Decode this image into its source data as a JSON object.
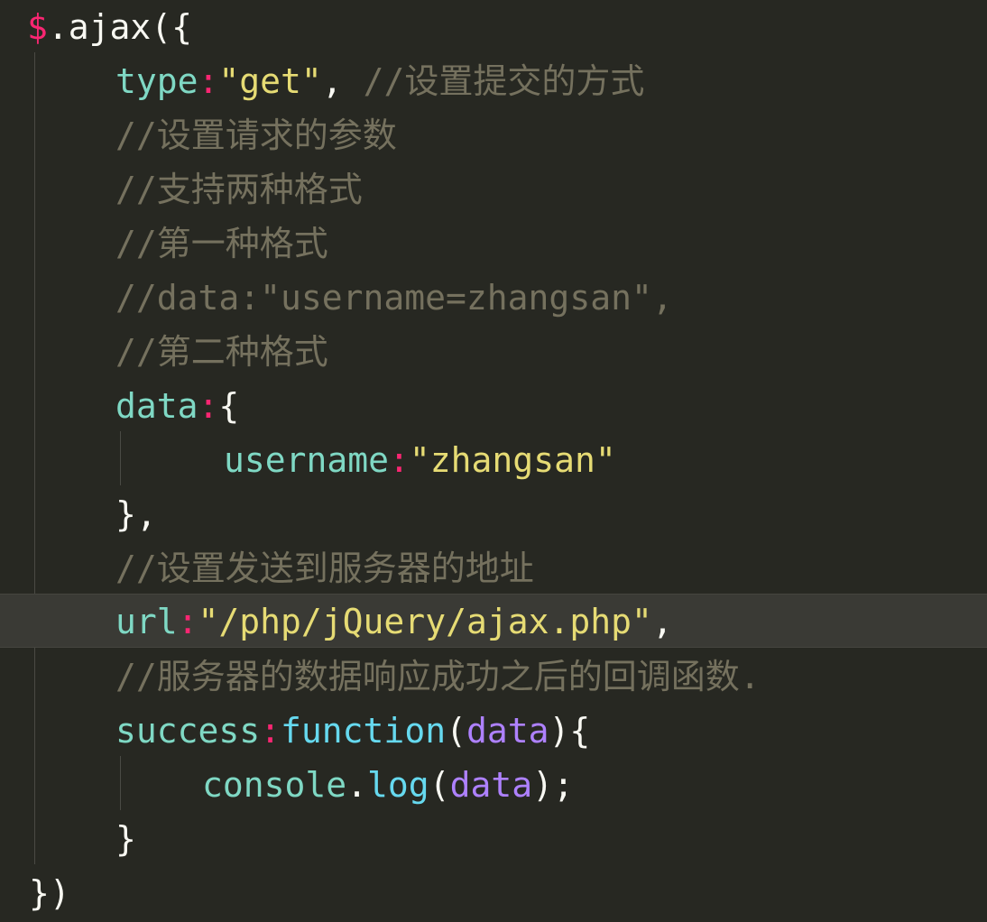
{
  "editor": {
    "theme_colors": {
      "background": "#272822",
      "dollar": "#f92672",
      "key": "#66d9ef",
      "string": "#e6db74",
      "comment": "#75715e",
      "param": "#ae81ff"
    },
    "code": {
      "l1": {
        "dollar": "$",
        "call": ".ajax({"
      },
      "l2": {
        "key": "type",
        "colon": ":",
        "value": "\"get\"",
        "sep": ",",
        "comment": " //设置提交的方式"
      },
      "l3": {
        "comment": "//设置请求的参数"
      },
      "l4": {
        "comment": "//支持两种格式"
      },
      "l5": {
        "comment": "//第一种格式"
      },
      "l6": {
        "comment": "//data:\"username=zhangsan\","
      },
      "l7": {
        "comment": "//第二种格式"
      },
      "l8": {
        "key": "data",
        "colon": ":",
        "brace": "{"
      },
      "l9": {
        "key": "username",
        "colon": ":",
        "value": "\"zhangsan\""
      },
      "l10": {
        "close": "},"
      },
      "l11": {
        "comment": "//设置发送到服务器的地址"
      },
      "l12": {
        "key": "url",
        "colon": ":",
        "value": "\"/php/jQuery/ajax.php\"",
        "sep": ","
      },
      "l13": {
        "comment": "//服务器的数据响应成功之后的回调函数."
      },
      "l14": {
        "key": "success",
        "colon": ":",
        "keyword": "function",
        "open": "(",
        "param": "data",
        "close": "){"
      },
      "l15": {
        "obj": "console",
        "dot": ".",
        "method": "log",
        "open": "(",
        "param": "data",
        "close": ");"
      },
      "l16": {
        "close": "}"
      },
      "l17": {
        "close": "})"
      }
    }
  }
}
